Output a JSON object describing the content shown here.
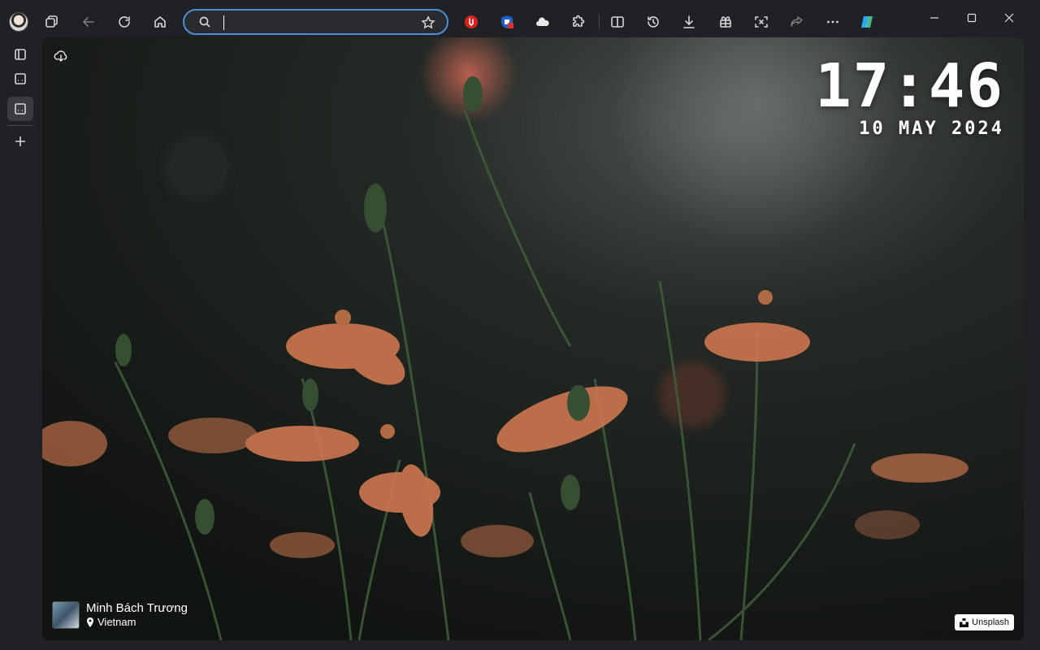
{
  "toolbar": {
    "profile": "profile-avatar",
    "workspaces": "workspaces-icon",
    "back": "back-arrow-icon",
    "refresh": "refresh-icon",
    "home": "home-icon",
    "address": {
      "value": "",
      "placeholder": ""
    },
    "favorite": "star-icon",
    "extensions": [
      "red-extension-icon",
      "shield-extension-icon",
      "cloud-extension-icon",
      "puzzle-extensions-icon"
    ],
    "actions": [
      "split-screen-icon",
      "history-icon",
      "downloads-icon",
      "collections-icon",
      "screenshot-icon",
      "share-icon",
      "more-icon",
      "copilot-icon"
    ],
    "window": [
      "minimize-icon",
      "maximize-icon",
      "close-icon"
    ]
  },
  "sidebar": {
    "items": [
      "tab-actions-icon",
      "vertical-tab-icon",
      "vertical-tab-active-icon",
      "new-tab-plus-icon"
    ]
  },
  "newtab": {
    "time": "17:46",
    "date": "10 MAY 2024",
    "photographer": "Minh Bách Trương",
    "location": "Vietnam",
    "source": "Unsplash"
  },
  "colors": {
    "accent": "#4a8fd8",
    "chrome": "#202124",
    "flower": "#e8875a"
  }
}
